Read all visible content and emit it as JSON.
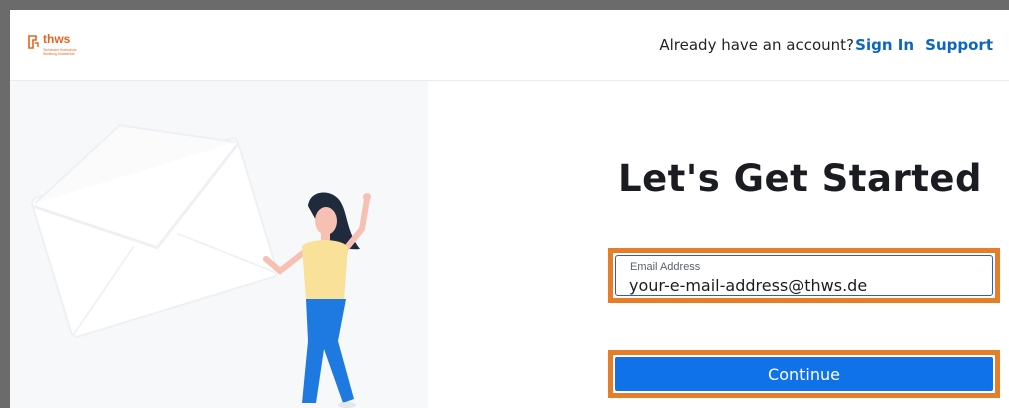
{
  "header": {
    "logo_name": "thws",
    "logo_tagline": "Technische Hochschule Würzburg-Schweinfurt",
    "account_prompt": "Already have an account?",
    "sign_in_label": "Sign In",
    "support_label": "Support"
  },
  "main": {
    "heading": "Let's Get Started",
    "email": {
      "label": "Email Address",
      "value": "your-e-mail-address@thws.de"
    },
    "continue_label": "Continue"
  },
  "colors": {
    "link": "#0a66c2",
    "primary_button": "#0f72e8",
    "highlight_border": "#e67e29",
    "brand": "#e8631c"
  },
  "icons": [
    "thws-logo-icon",
    "envelope-illustration",
    "woman-waving-illustration"
  ]
}
